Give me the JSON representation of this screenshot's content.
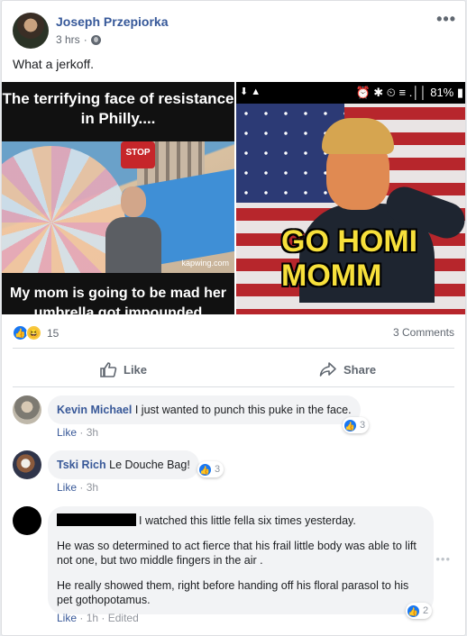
{
  "post": {
    "author": "Joseph Przepiorka",
    "time": "3 hrs",
    "separator": "·",
    "more_icon": "ellipsis-icon",
    "text": "What a jerkoff."
  },
  "images": {
    "left": {
      "top_caption": "The terrifying face of resistance in Philly....",
      "stop_sign": "STOP",
      "watermark": "kapwing.com",
      "bottom_caption": "My mom is going to be mad her umbrella got impounded"
    },
    "right": {
      "status_left": "⬇ ▲",
      "status_right": "⏰ ✱ ⏲ ≡ .││ 81% ▮",
      "caption": "GO HOMI\nMOMM"
    }
  },
  "stats": {
    "reaction_count": "15",
    "comments": "3 Comments"
  },
  "actions": {
    "like": "Like",
    "share": "Share"
  },
  "comments": [
    {
      "name": "Kevin Michael",
      "text": "I just wanted to punch this puke in the face.",
      "like": "Like",
      "dot": "·",
      "time": "3h",
      "reactions": "3"
    },
    {
      "name": "Tski Rich",
      "text": "Le Douche Bag!",
      "like": "Like",
      "dot": "·",
      "time": "3h",
      "reactions": "3"
    },
    {
      "name": "",
      "paragraphs": [
        "I watched this little fella six times yesterday.",
        "He was so determined to act fierce that his frail little body was able to lift not one, but two middle fingers in the air .",
        "He really showed them, right before handing off his floral parasol to his pet gothopotamus."
      ],
      "like": "Like",
      "dot": "·",
      "time": "1h",
      "edited": "Edited",
      "reactions": "2"
    }
  ],
  "colors": {
    "link": "#365899",
    "like_blue": "#1877f2",
    "muted": "#606770",
    "bubble": "#f2f3f5"
  }
}
